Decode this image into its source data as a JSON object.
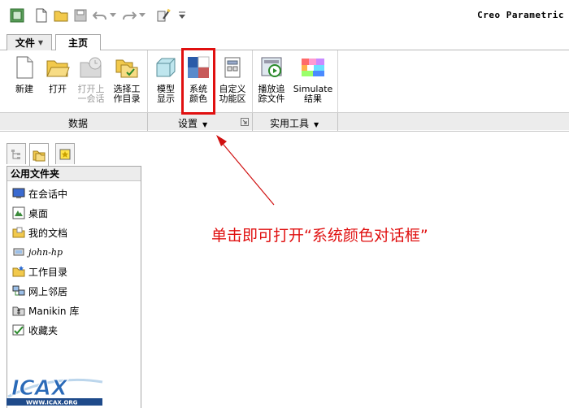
{
  "app": {
    "title": "Creo Parametric"
  },
  "tabs": {
    "file": "文件",
    "home": "主页"
  },
  "ribbon": {
    "buttons": {
      "new": "新建",
      "open": "打开",
      "open_session": "打开上\n一会话",
      "select_dir": "选择工\n作目录",
      "model_display": "模型\n显示",
      "system_colors": "系统\n颜色",
      "customize": "自定义\n功能区",
      "play_trail": "播放追\n踪文件",
      "simulate": "Simulate\n结果"
    },
    "groups": {
      "data": "数据",
      "settings": "设置",
      "utilities": "实用工具"
    }
  },
  "navigator": {
    "header": "公用文件夹",
    "items": [
      "在会话中",
      "桌面",
      "我的文档",
      "john-hp",
      "工作目录",
      "网上邻居",
      "Manikin 库",
      "收藏夹"
    ]
  },
  "annotation": {
    "text": "单击即可打开“系统颜色对话框”",
    "color": "#e01010"
  },
  "logo": {
    "text": "ICAX",
    "subtext": "WWW.ICAX.ORG"
  },
  "colors": {
    "highlight": "#e01010",
    "group_bar": "#ececec"
  }
}
